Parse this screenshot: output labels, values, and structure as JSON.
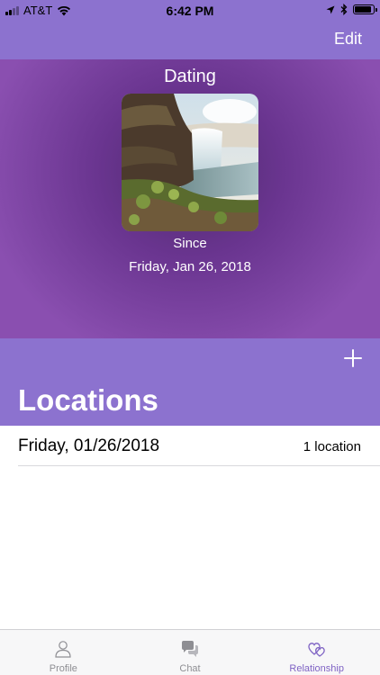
{
  "status_bar": {
    "carrier": "AT&T",
    "time": "6:42 PM",
    "battery_level": 0.9
  },
  "nav": {
    "edit_label": "Edit"
  },
  "relationship": {
    "status": "Dating",
    "since_label": "Since",
    "since_date": "Friday, Jan 26, 2018"
  },
  "locations": {
    "title": "Locations",
    "items": [
      {
        "date": "Friday, 01/26/2018",
        "count": "1 location"
      }
    ]
  },
  "tabs": [
    {
      "label": "Profile",
      "icon": "person-icon",
      "active": false
    },
    {
      "label": "Chat",
      "icon": "chat-bubbles-icon",
      "active": false
    },
    {
      "label": "Relationship",
      "icon": "hearts-icon",
      "active": true
    }
  ],
  "colors": {
    "accent": "#8c72cf",
    "hero_dark": "#4f2a6e",
    "tab_active": "#7f63c4",
    "tab_inactive": "#8e8e93"
  }
}
